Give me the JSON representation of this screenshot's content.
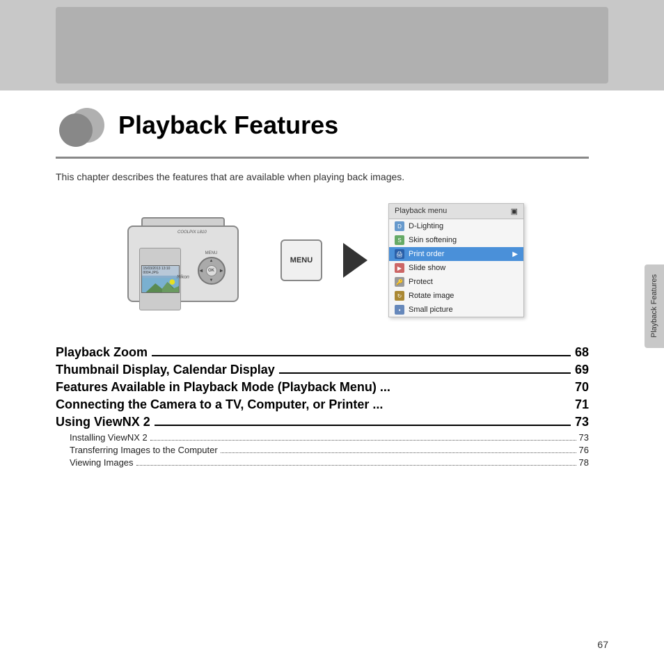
{
  "top_banner": {
    "visible": true
  },
  "chapter": {
    "title": "Playback Features",
    "description": "This chapter describes the features that are available when playing back images."
  },
  "playback_menu": {
    "header": "Playback menu",
    "items": [
      {
        "label": "D-Lighting",
        "icon": "D",
        "highlighted": false
      },
      {
        "label": "Skin softening",
        "icon": "S",
        "highlighted": false
      },
      {
        "label": "Print order",
        "icon": "P",
        "highlighted": true,
        "arrow": "▶"
      },
      {
        "label": "Slide show",
        "icon": "SL",
        "highlighted": false
      },
      {
        "label": "Protect",
        "icon": "O",
        "highlighted": false
      },
      {
        "label": "Rotate image",
        "icon": "R",
        "highlighted": false
      },
      {
        "label": "Small picture",
        "icon": "SM",
        "highlighted": false
      }
    ]
  },
  "menu_button": {
    "label": "MENU"
  },
  "camera": {
    "brand": "Nikon",
    "model": "COOLPIX L810"
  },
  "toc": {
    "entries_main": [
      {
        "title": "Playback Zoom",
        "dots": true,
        "page": "68"
      },
      {
        "title": "Thumbnail Display, Calendar Display",
        "dots": true,
        "page": "69"
      },
      {
        "title": "Features Available in Playback Mode (Playback Menu)",
        "dots": false,
        "suffix": "...",
        "page": "70"
      },
      {
        "title": "Connecting the Camera to a TV, Computer, or Printer",
        "dots": false,
        "suffix": "...",
        "page": "71"
      },
      {
        "title": "Using ViewNX 2",
        "dots": true,
        "page": "73"
      }
    ],
    "entries_sub": [
      {
        "title": "Installing ViewNX 2",
        "page": "73"
      },
      {
        "title": "Transferring Images to the Computer",
        "page": "76"
      },
      {
        "title": "Viewing Images",
        "page": "78"
      }
    ]
  },
  "right_tab": {
    "label": "Playback Features"
  },
  "page_number": "67"
}
